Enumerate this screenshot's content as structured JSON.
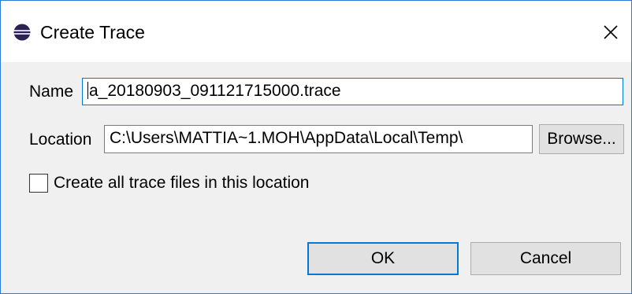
{
  "dialog": {
    "title": "Create Trace",
    "icon": "eclipse-icon",
    "close_icon": "close-icon"
  },
  "name_field": {
    "label": "Name",
    "value": "a_20180903_091121715000.trace"
  },
  "location_field": {
    "label": "Location",
    "value": "C:\\Users\\MATTIA~1.MOH\\AppData\\Local\\Temp\\",
    "browse_label": "Browse..."
  },
  "checkbox": {
    "label": "Create all trace files in this location",
    "checked": false
  },
  "buttons": {
    "ok_label": "OK",
    "cancel_label": "Cancel"
  },
  "colors": {
    "accent": "#0078d7",
    "window_border": "#2b7bd6",
    "dialog_background": "#f0f0f0",
    "button_background": "#e1e1e1"
  }
}
